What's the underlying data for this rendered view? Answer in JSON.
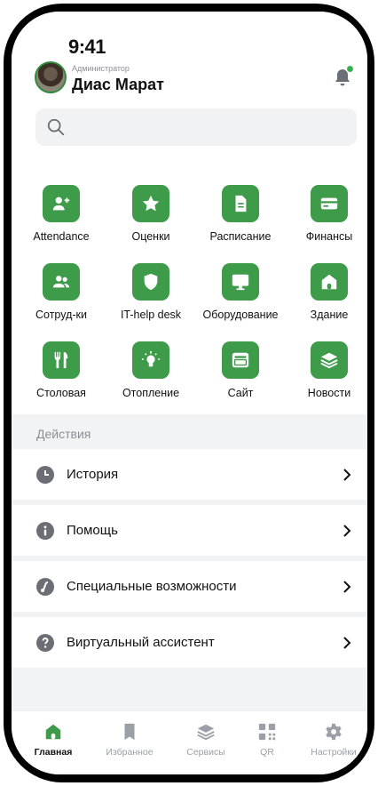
{
  "status_bar": {
    "time": "9:41"
  },
  "header": {
    "role": "Администратор",
    "user_name": "Диас Марат"
  },
  "search": {
    "placeholder": "",
    "value": ""
  },
  "services": [
    {
      "label": "Attendance",
      "icon": "add-user-icon"
    },
    {
      "label": "Оценки",
      "icon": "star-icon"
    },
    {
      "label": "Расписание",
      "icon": "document-icon"
    },
    {
      "label": "Финансы",
      "icon": "card-icon"
    },
    {
      "label": "Сотруд-ки",
      "icon": "people-icon"
    },
    {
      "label": "IT-help desk",
      "icon": "shield-icon"
    },
    {
      "label": "Оборудование",
      "icon": "monitor-icon"
    },
    {
      "label": "Здание",
      "icon": "home-icon"
    },
    {
      "label": "Столовая",
      "icon": "cutlery-icon"
    },
    {
      "label": "Отопление",
      "icon": "bulb-icon"
    },
    {
      "label": "Сайт",
      "icon": "browser-icon"
    },
    {
      "label": "Новости",
      "icon": "layers-icon"
    }
  ],
  "actions": {
    "title": "Действия",
    "items": [
      {
        "label": "История",
        "icon": "clock-icon"
      },
      {
        "label": "Помощь",
        "icon": "info-icon"
      },
      {
        "label": "Специальные возможности",
        "icon": "accessibility-icon"
      },
      {
        "label": "Виртуальный ассистент",
        "icon": "question-icon"
      }
    ]
  },
  "tabbar": [
    {
      "label": "Главная",
      "icon": "home-icon",
      "active": true
    },
    {
      "label": "Избранное",
      "icon": "bookmark-icon",
      "active": false
    },
    {
      "label": "Сервисы",
      "icon": "layers-icon",
      "active": false
    },
    {
      "label": "QR",
      "icon": "qr-icon",
      "active": false
    },
    {
      "label": "Настройки",
      "icon": "gear-icon",
      "active": false
    }
  ],
  "colors": {
    "accent": "#3e9b4a",
    "notification": "#35b24a",
    "muted": "#8a8f97"
  }
}
